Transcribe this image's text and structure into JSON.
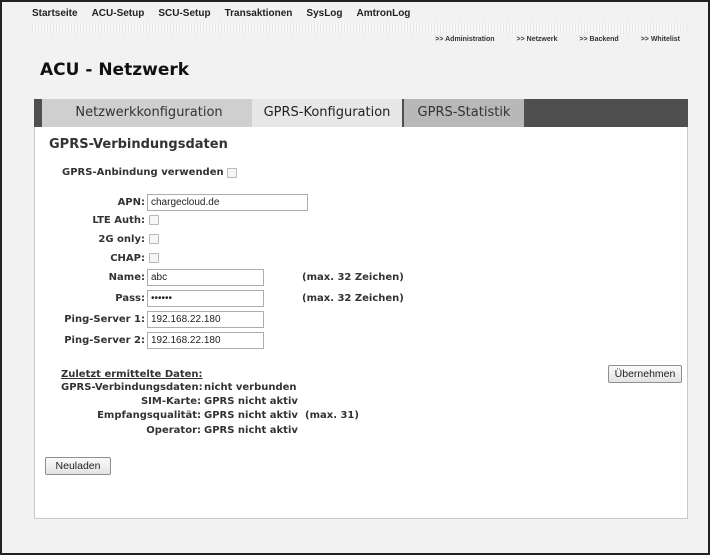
{
  "topnav": [
    "Startseite",
    "ACU-Setup",
    "SCU-Setup",
    "Transaktionen",
    "SysLog",
    "AmtronLog"
  ],
  "subnav": [
    ">> Administration",
    ">> Netzwerk",
    ">> Backend",
    ">> Whitelist"
  ],
  "page_title": "ACU - Netzwerk",
  "tabs": [
    "Netzwerkkonfiguration",
    "GPRS-Konfiguration",
    "GPRS-Statistik"
  ],
  "section_title": "GPRS-Verbindungsdaten",
  "gprs_enable_label": "GPRS-Anbindung verwenden",
  "fields": {
    "apn": {
      "label": "APN:",
      "value": "chargecloud.de"
    },
    "lte_auth": {
      "label": "LTE Auth:"
    },
    "only2g": {
      "label": "2G only:"
    },
    "chap": {
      "label": "CHAP:"
    },
    "name": {
      "label": "Name:",
      "value": "abc",
      "hint": "(max. 32 Zeichen)"
    },
    "pass": {
      "label": "Pass:",
      "value": "••••••",
      "hint": "(max. 32 Zeichen)"
    },
    "ping1": {
      "label": "Ping-Server 1:",
      "value": "192.168.22.180"
    },
    "ping2": {
      "label": "Ping-Server 2:",
      "value": "192.168.22.180"
    }
  },
  "status": {
    "heading": "Zuletzt ermittelte Daten:",
    "conn_label": "GPRS-Verbindungsdaten:",
    "conn_value": "nicht verbunden",
    "sim_label": "SIM-Karte:",
    "sim_value": "GPRS nicht aktiv",
    "signal_label": "Empfangsqualität:",
    "signal_value": "GPRS nicht aktiv",
    "signal_max": "(max. 31)",
    "operator_label": "Operator:",
    "operator_value": "GPRS nicht aktiv"
  },
  "buttons": {
    "apply": "Übernehmen",
    "reload": "Neuladen"
  }
}
